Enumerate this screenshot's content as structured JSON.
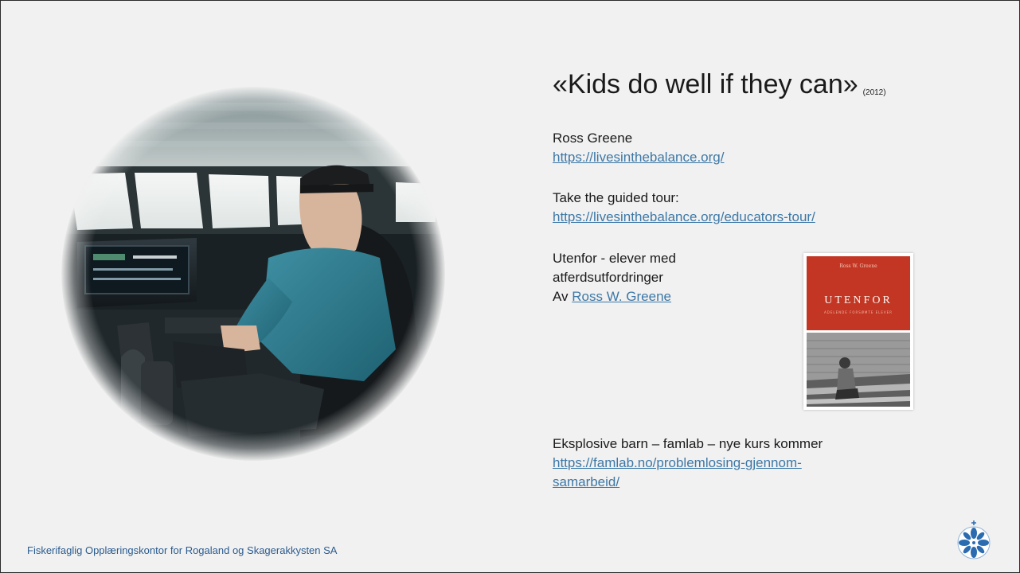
{
  "title": {
    "main": "«Kids do well if they can»",
    "year": "(2012)"
  },
  "author_block": {
    "name": "Ross Greene",
    "url": "https://livesinthebalance.org/"
  },
  "tour_block": {
    "label": "Take the guided tour:",
    "url": "https://livesinthebalance.org/educators-tour/"
  },
  "book_block": {
    "line1": "Utenfor - elever med",
    "line2": "atferdsutfordringer",
    "by_prefix": "Av",
    "author_link": "Ross W. Greene",
    "cover": {
      "author": "Ross W. Greene",
      "title": "UTENFOR",
      "subtitle": "ADELENDE FORSØMTE ELEVER",
      "color": "#c33624"
    }
  },
  "course_block": {
    "label": "Eksplosive barn – famlab – nye kurs kommer",
    "url_line1": "https://famlab.no/problemlosing-gjennom-",
    "url_line2": "samarbeid/"
  },
  "footer": {
    "text": "Fiskerifaglig Opplæringskontor for Rogaland og Skagerakkysten SA"
  },
  "logo": {
    "icon": "snowflake-compass-logo",
    "color": "#2b6cb0"
  }
}
